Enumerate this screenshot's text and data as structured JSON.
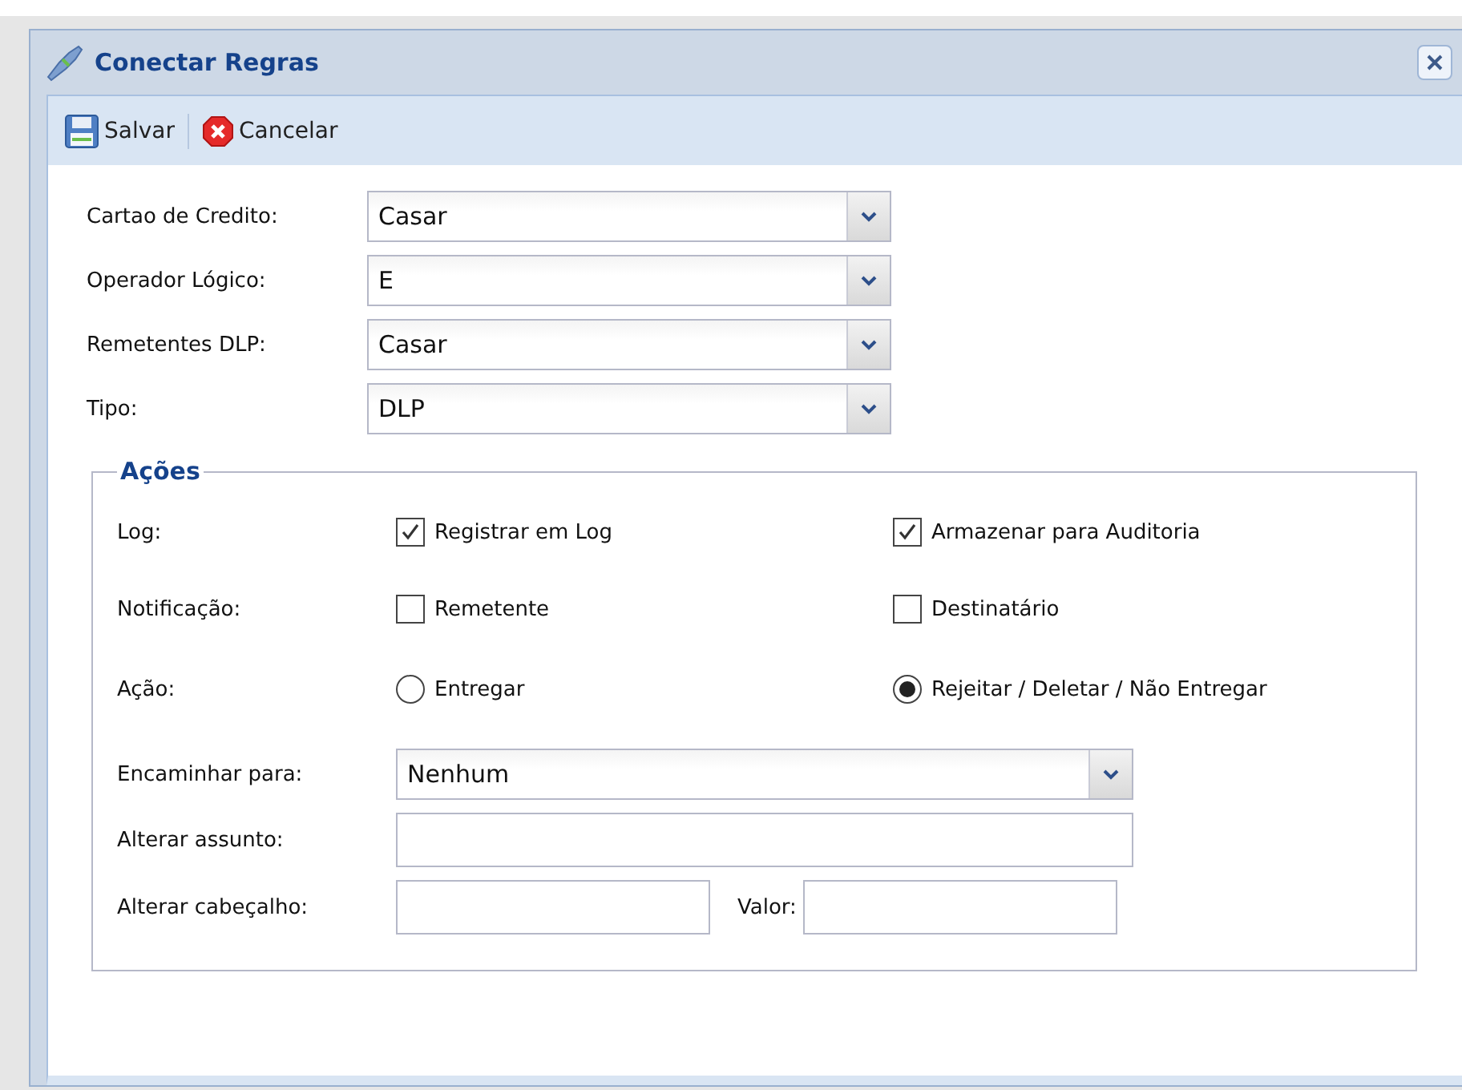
{
  "window": {
    "title": "Conectar Regras"
  },
  "toolbar": [
    {
      "kind": "save",
      "label": "Salvar"
    },
    {
      "kind": "cancel",
      "label": "Cancelar"
    }
  ],
  "selects": [
    {
      "label": "Cartao de Credito:",
      "value": "Casar"
    },
    {
      "label": "Operador Lógico:",
      "value": "E"
    },
    {
      "label": "Remetentes DLP:",
      "value": "Casar"
    },
    {
      "label": "Tipo:",
      "value": "DLP"
    }
  ],
  "actions": {
    "legend": "Ações",
    "option_rows": [
      {
        "label": "Log:",
        "kind": "checkbox",
        "options": [
          {
            "label": "Registrar em Log",
            "checked": true
          },
          {
            "label": "Armazenar para Auditoria",
            "checked": true
          }
        ]
      },
      {
        "label": "Notificação:",
        "kind": "checkbox",
        "options": [
          {
            "label": "Remetente",
            "checked": false
          },
          {
            "label": "Destinatário",
            "checked": false
          }
        ]
      },
      {
        "label": "Ação:",
        "kind": "radio",
        "options": [
          {
            "label": "Entregar",
            "selected": false
          },
          {
            "label": "Rejeitar / Deletar / Não Entregar",
            "selected": true
          }
        ]
      }
    ],
    "forward": {
      "label": "Encaminhar para:",
      "value": "Nenhum"
    },
    "subject": {
      "label": "Alterar assunto:"
    },
    "header": {
      "label": "Alterar cabeçalho:",
      "value_label": "Valor:"
    }
  }
}
